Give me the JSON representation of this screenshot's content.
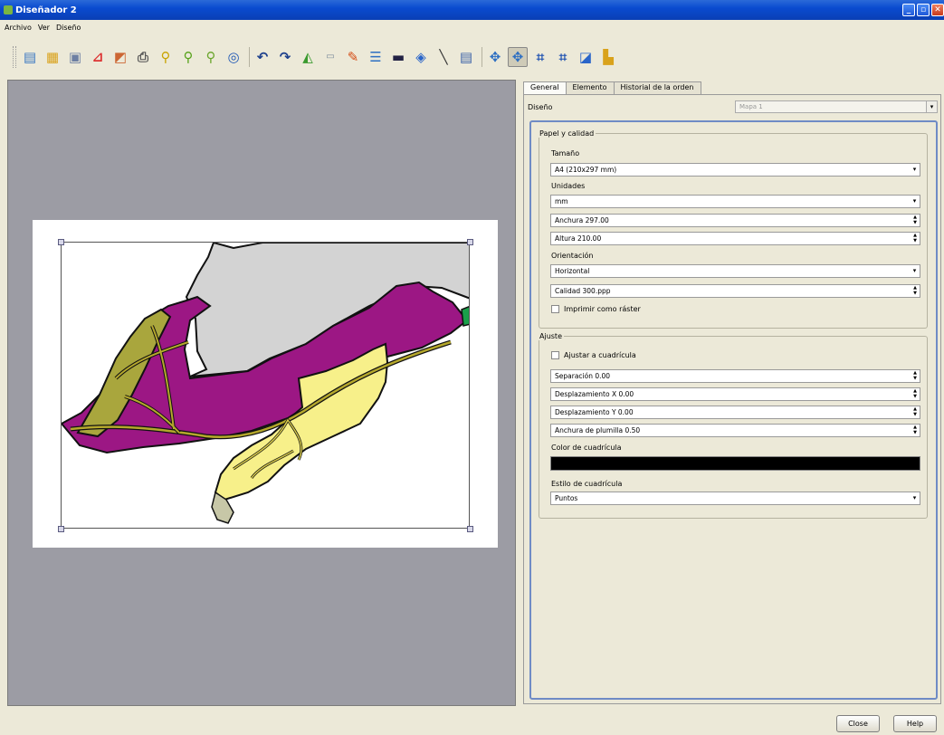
{
  "window": {
    "title": "Diseñador 2"
  },
  "menu": [
    "Archivo",
    "Ver",
    "Diseño"
  ],
  "toolbar_icons": [
    "open-template-icon",
    "save-template-icon",
    "export-image-icon",
    "export-pdf-icon",
    "export-svg-icon",
    "print-icon",
    "zoom-full-icon",
    "zoom-in-icon",
    "zoom-out-icon",
    "refresh-icon",
    "undo-icon",
    "redo-icon",
    "add-map-icon",
    "add-image-icon",
    "add-label-icon",
    "add-legend-icon",
    "add-scalebar-icon",
    "add-shape-icon",
    "add-arrow-icon",
    "add-table-icon",
    "select-move-icon",
    "move-content-icon",
    "group-icon",
    "ungroup-icon",
    "raise-icon",
    "align-icon"
  ],
  "tabs": [
    "General",
    "Elemento",
    "Historial de la orden"
  ],
  "active_tab": "General",
  "disenio": {
    "label": "Diseño",
    "value": "Mapa 1"
  },
  "paper_quality": {
    "title": "Papel y calidad",
    "size_label": "Tamaño",
    "size_value": "A4 (210x297 mm)",
    "units_label": "Unidades",
    "units_value": "mm",
    "width": "Anchura 297.00",
    "height": "Altura 210.00",
    "orientation_label": "Orientación",
    "orientation_value": "Horizontal",
    "quality": "Calidad 300.ppp",
    "raster_label": "Imprimir como ráster"
  },
  "snap": {
    "title": "Ajuste",
    "snap_grid_label": "Ajustar a cuadrícula",
    "spacing": "Separación 0.00",
    "offset_x": "Desplazamiento X 0.00",
    "offset_y": "Desplazamiento Y 0.00",
    "pen_width": "Anchura de plumilla 0.50",
    "grid_color_label": "Color de cuadrícula",
    "grid_color": "#000000",
    "grid_style_label": "Estilo de cuadrícula",
    "grid_style_value": "Puntos"
  },
  "buttons": {
    "close": "Close",
    "help": "Help"
  },
  "colors": {
    "magenta": "#9c1784",
    "yellow": "#f7f08a",
    "gray": "#d3d3d3",
    "olive": "#a9a63d",
    "green": "#1aa04a"
  }
}
